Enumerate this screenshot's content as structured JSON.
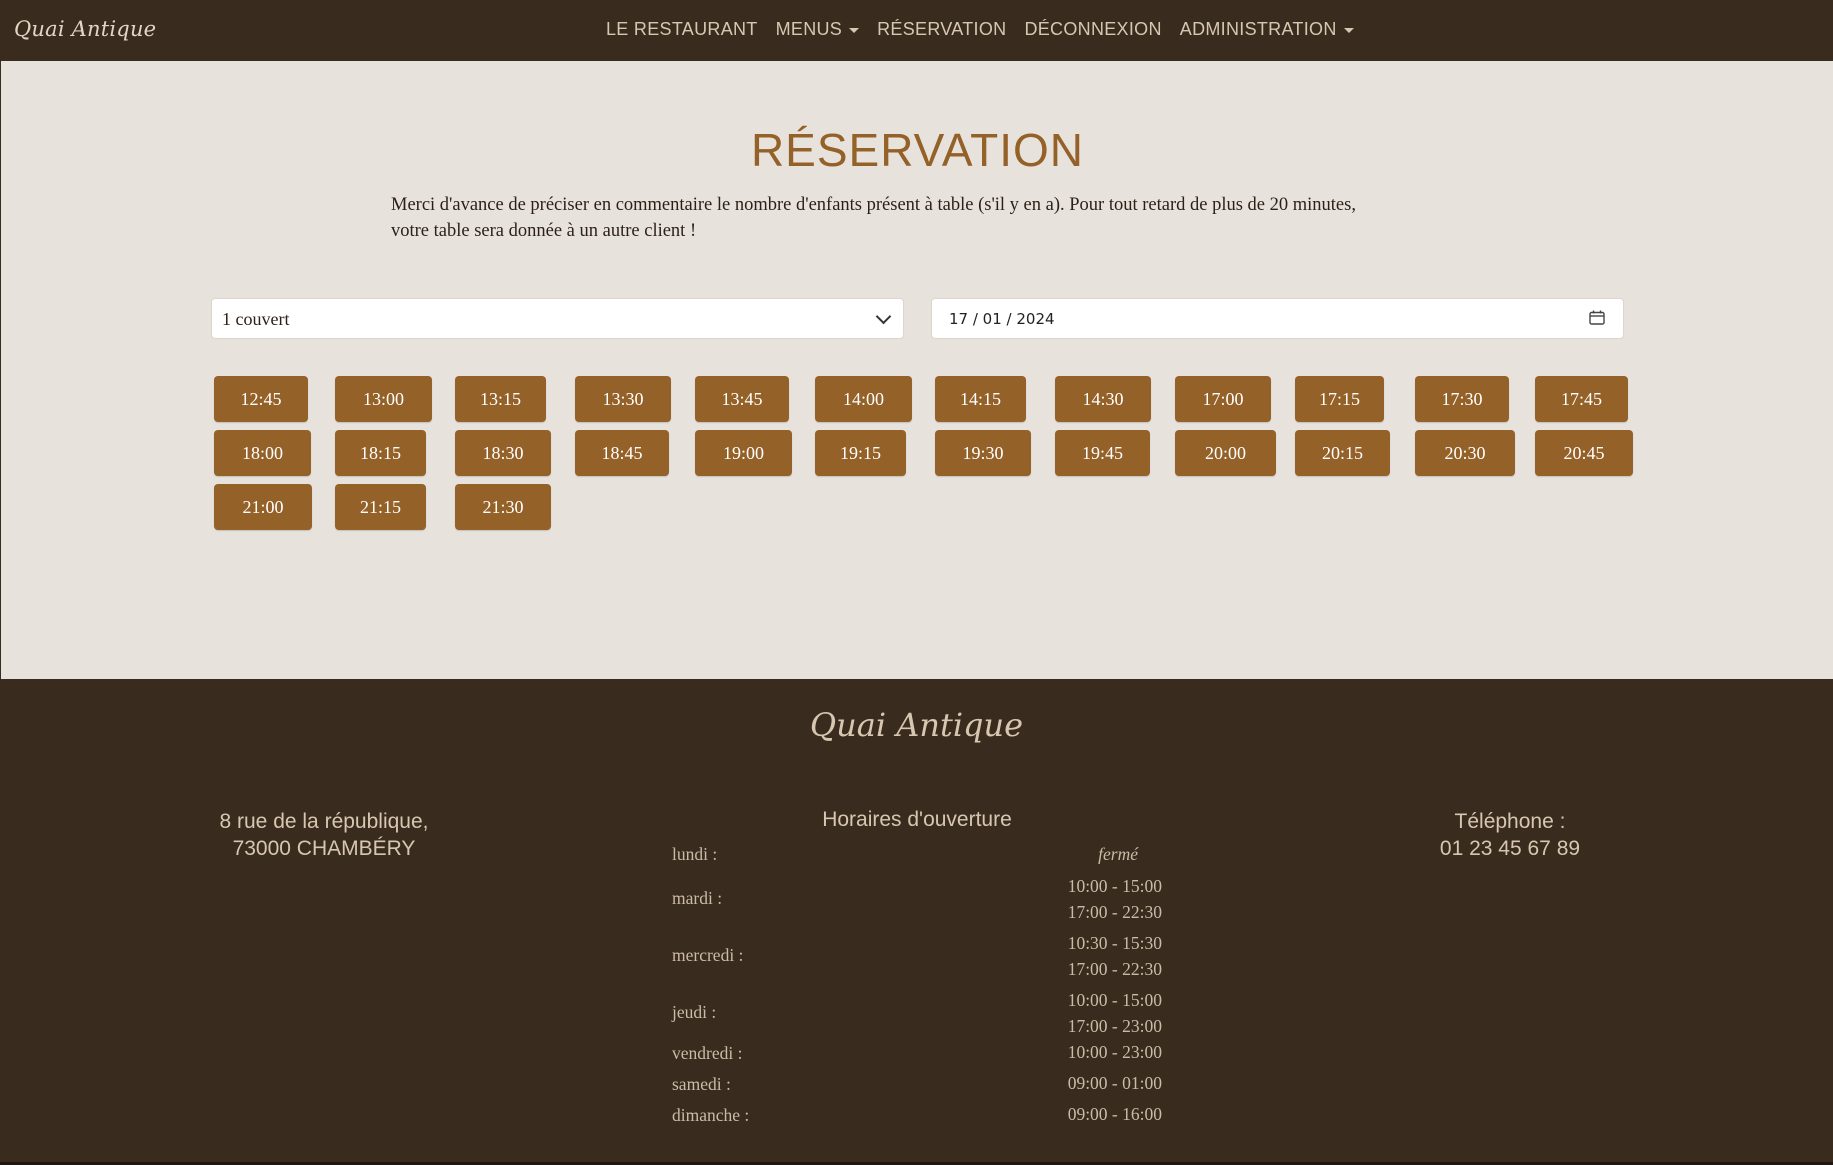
{
  "brand": "Quai Antique",
  "nav": {
    "items": [
      {
        "label": "LE RESTAURANT",
        "dropdown": false
      },
      {
        "label": "MENUS",
        "dropdown": true
      },
      {
        "label": "RÉSERVATION",
        "dropdown": false
      },
      {
        "label": "DÉCONNEXION",
        "dropdown": false
      },
      {
        "label": "ADMINISTRATION",
        "dropdown": true
      }
    ]
  },
  "reservation": {
    "title": "RÉSERVATION",
    "intro": "Merci d'avance de préciser en commentaire le nombre d'enfants présent à table (s'il y en a). Pour tout retard de plus de 20 minutes, votre table sera donnée à un autre client !",
    "guests_selected": "1 couvert",
    "date_value": "17 / 01 / 2024",
    "slots": [
      "12:45",
      "13:00",
      "13:15",
      "13:30",
      "13:45",
      "14:00",
      "14:15",
      "14:30",
      "17:00",
      "17:15",
      "17:30",
      "17:45",
      "18:00",
      "18:15",
      "18:30",
      "18:45",
      "19:00",
      "19:15",
      "19:30",
      "19:45",
      "20:00",
      "20:15",
      "20:30",
      "20:45",
      "21:00",
      "21:15",
      "21:30"
    ]
  },
  "footer": {
    "brand": "Quai Antique",
    "address_line1": "8 rue de la république,",
    "address_line2": "73000 CHAMBÉRY",
    "hours_title": "Horaires d'ouverture",
    "hours": [
      {
        "day": "lundi :",
        "closed": "fermé",
        "times": []
      },
      {
        "day": "mardi :",
        "times": [
          "10:00 - 15:00",
          "17:00 - 22:30"
        ]
      },
      {
        "day": "mercredi :",
        "times": [
          "10:30 - 15:30",
          "17:00 - 22:30"
        ]
      },
      {
        "day": "jeudi :",
        "times": [
          "10:00 - 15:00",
          "17:00 - 23:00"
        ]
      },
      {
        "day": "vendredi :",
        "times": [
          "10:00 - 23:00"
        ]
      },
      {
        "day": "samedi :",
        "times": [
          "09:00 - 01:00"
        ]
      },
      {
        "day": "dimanche :",
        "times": [
          "09:00 - 16:00"
        ]
      }
    ],
    "phone_label": "Téléphone :",
    "phone_number": "01 23 45 67 89"
  },
  "colors": {
    "header_footer_bg": "#3a2b1f",
    "main_bg": "#e8e2dd",
    "accent": "#946128",
    "nav_text": "#d7c7b0"
  }
}
